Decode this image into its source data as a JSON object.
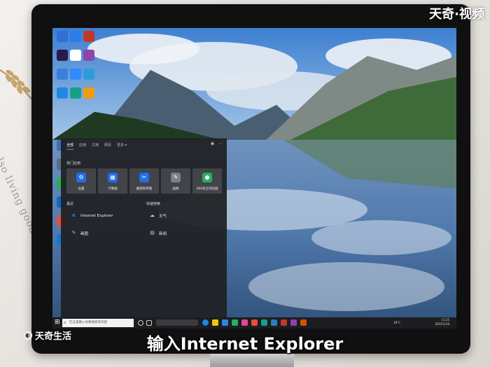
{
  "watermarks": {
    "top_right": "天奇·视频",
    "bottom_left": "天奇生活"
  },
  "paper_text": "also living good",
  "subtitle": "输入Internet Explorer",
  "desktop_icons": [
    {
      "icon": "person-icon",
      "color": "#2f6fd6"
    },
    {
      "icon": "maxthon-icon",
      "color": "#2b7de9"
    },
    {
      "icon": "app-icon",
      "color": "#c0392b"
    },
    {
      "icon": "premiere-icon",
      "color": "#2a1a4a"
    },
    {
      "icon": "qq-icon",
      "color": "#ffffff"
    },
    {
      "icon": "winrar-icon",
      "color": "#8e44ad"
    },
    {
      "icon": "chart-app-icon",
      "color": "#3c7fd9"
    },
    {
      "icon": "baidu-netdisk-icon",
      "color": "#2f8bff"
    },
    {
      "icon": "feishu-icon",
      "color": "#2d9cdb"
    },
    {
      "icon": "edge-icon",
      "color": "#1e88e5"
    },
    {
      "icon": "media-player-icon",
      "color": "#16a085"
    },
    {
      "icon": "archive-icon",
      "color": "#f39c12"
    },
    {
      "icon": "file-icon",
      "color": "#3d6fb8"
    },
    {
      "icon": "doc-icon",
      "color": "#5a6c7d"
    },
    {
      "icon": "wechat-icon",
      "color": "#22b14c"
    },
    {
      "icon": "security-icon",
      "color": "#1565c0"
    },
    {
      "icon": "video-icon",
      "color": "#e74c3c"
    },
    {
      "icon": "edge-icon",
      "color": "#0e7acd"
    }
  ],
  "start_menu": {
    "tabs": [
      "全部",
      "应用",
      "文档",
      "网页",
      "更多 ▾"
    ],
    "top_apps_title": "热门应用",
    "top_apps": [
      {
        "label": "设置",
        "icon": "gear-icon",
        "glyph": "⚙",
        "color": "#1f6feb"
      },
      {
        "label": "计算器",
        "icon": "calculator-icon",
        "glyph": "▦",
        "color": "#1f6feb"
      },
      {
        "label": "截图和草图",
        "icon": "snip-icon",
        "glyph": "✂",
        "color": "#1f6feb"
      },
      {
        "label": "画图",
        "icon": "paint-icon",
        "glyph": "✎",
        "color": "#9aa0a6"
      },
      {
        "label": "360安全浏览器",
        "icon": "360-browser-icon",
        "glyph": "●",
        "color": "#2ecc71"
      }
    ],
    "recent_title": "最近",
    "recent": [
      {
        "label": "Internet Explorer",
        "icon": "internet-explorer-icon",
        "glyph": "e",
        "color": "#1e88e5"
      },
      {
        "label": "画图",
        "icon": "paint-icon",
        "glyph": "✎",
        "color": "#9aa0a6"
      }
    ],
    "quick_title": "快速搜索",
    "quick": [
      {
        "label": "天气",
        "icon": "weather-icon",
        "glyph": "☁",
        "color": "#cccccc"
      },
      {
        "label": "新闻",
        "icon": "news-icon",
        "glyph": "▤",
        "color": "#cccccc"
      }
    ]
  },
  "taskbar": {
    "search_placeholder": "在这里输入你要搜索的内容",
    "temperature": "18°C",
    "time": "11:25",
    "date": "2022/1/16"
  }
}
